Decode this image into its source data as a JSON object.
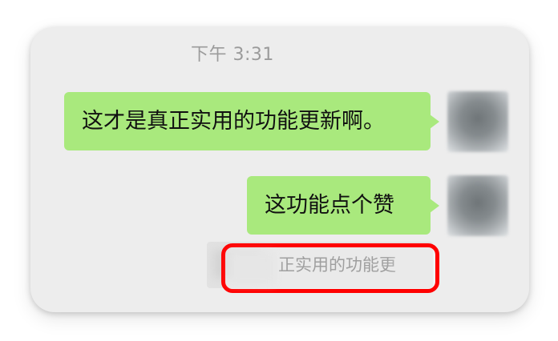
{
  "chat": {
    "timestamp": "下午 3:31",
    "messages": [
      {
        "text": "这才是真正实用的功能更新啊。",
        "avatar_icon": "user-avatar-blurred"
      },
      {
        "text": "这功能点个赞",
        "avatar_icon": "user-avatar-blurred"
      }
    ],
    "quote": {
      "text": "：正实用的功能更"
    }
  },
  "colors": {
    "bubble": "#a9e97d",
    "background": "#ededed",
    "highlight": "#ff0000"
  }
}
